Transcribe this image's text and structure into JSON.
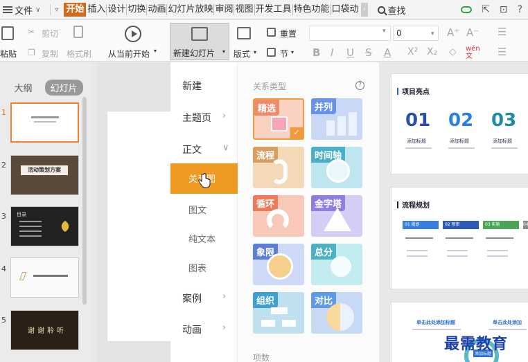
{
  "menubar": {
    "file_label": "文件",
    "tabs": [
      "开始",
      "插入",
      "设计",
      "切换",
      "动画",
      "幻灯片放映",
      "审阅",
      "视图",
      "开发工具",
      "特色功能",
      "口袋动"
    ],
    "search_label": "查找"
  },
  "ribbon": {
    "cut": "剪切",
    "copy": "复制",
    "paste": "粘贴",
    "format_painter": "格式刷",
    "from_current": "从当前开始",
    "new_slide": "新建幻灯片",
    "layout": "版式",
    "reset": "重置",
    "section": "节",
    "font_size": "0",
    "wen": "wén\n文"
  },
  "left_pane": {
    "tabs": [
      "大纲",
      "幻灯片"
    ],
    "active_tab": "幻灯片",
    "slide_numbers": [
      "1",
      "2",
      "3",
      "4",
      "5"
    ],
    "thumb2_title": "活动策划方案",
    "thumb3_title": "目录",
    "thumb5_title": "谢谢聆听"
  },
  "dropdown": {
    "new": "新建",
    "theme_page": "主题页",
    "body": "正文",
    "relationship": "关系图",
    "image_text": "图文",
    "plain_text": "纯文本",
    "chart": "图表",
    "cases": "案例",
    "animation": "动画"
  },
  "rel_panel": {
    "title": "关系类型",
    "items_title": "项数",
    "cards": [
      {
        "label": "精选",
        "color": "#ef8a6a"
      },
      {
        "label": "并列",
        "color": "#6a93e8"
      },
      {
        "label": "流程",
        "color": "#d8a060"
      },
      {
        "label": "时间轴",
        "color": "#4ab0c8"
      },
      {
        "label": "循环",
        "color": "#ef7a5a"
      },
      {
        "label": "金字塔",
        "color": "#8f7ee0"
      },
      {
        "label": "象限",
        "color": "#5b7ed8"
      },
      {
        "label": "总分",
        "color": "#4ab2c0"
      },
      {
        "label": "组织",
        "color": "#3f9fcf"
      },
      {
        "label": "对比",
        "color": "#5f9ae8"
      }
    ]
  },
  "preview": {
    "slide1_title": "项目亮点",
    "slide1_numbers": [
      "01",
      "02",
      "03"
    ],
    "slide1_labels": [
      "添加标题",
      "添加标题",
      "添加标题"
    ],
    "slide2_title": "流程规划",
    "slide2_steps": [
      "01 规划",
      "02 预审",
      "03 实施",
      "04"
    ],
    "slide3_head1": "单击此处添加标题",
    "slide3_head2": "单击此处添加",
    "slide3_center": "添加标题"
  },
  "watermark": "最需教育"
}
